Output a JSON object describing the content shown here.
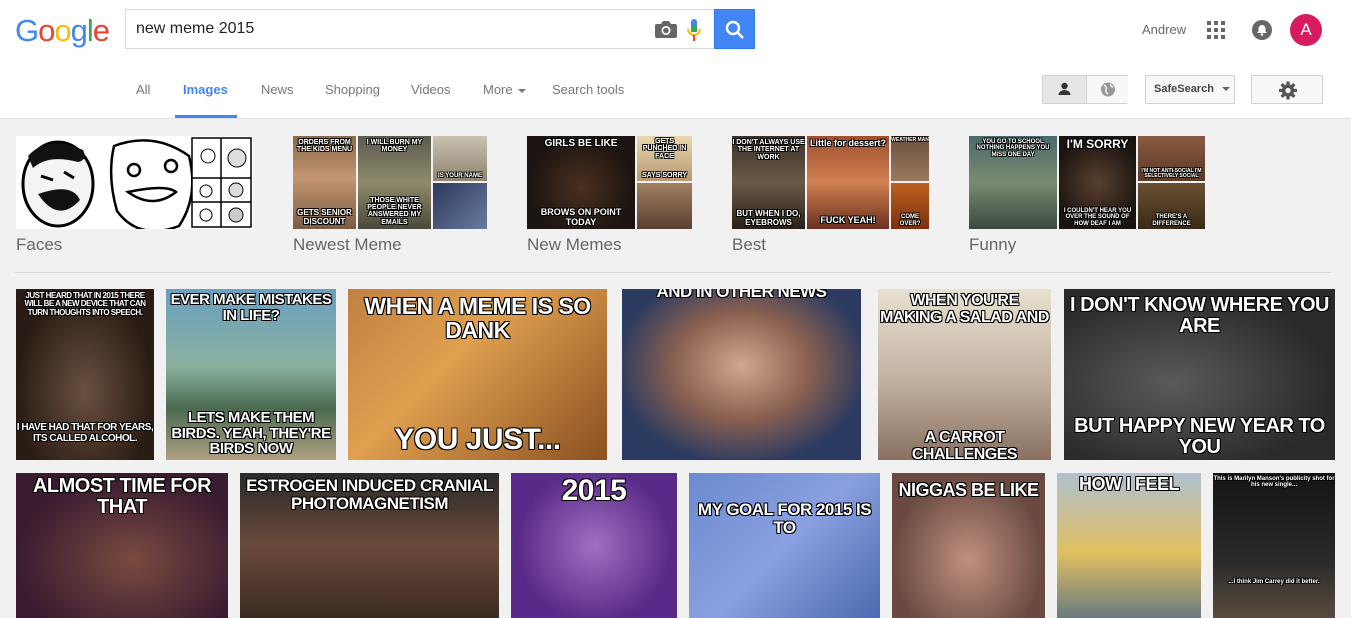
{
  "logo": {
    "letters": [
      "G",
      "o",
      "o",
      "g",
      "l",
      "e"
    ],
    "colors": [
      "#4285f4",
      "#ea4335",
      "#fbbc05",
      "#4285f4",
      "#34a853",
      "#ea4335"
    ]
  },
  "search": {
    "query": "new meme 2015"
  },
  "header": {
    "user_name": "Andrew",
    "avatar_letter": "A"
  },
  "tabs": [
    {
      "label": "All",
      "active": false
    },
    {
      "label": "Images",
      "active": true
    },
    {
      "label": "News",
      "active": false
    },
    {
      "label": "Shopping",
      "active": false
    },
    {
      "label": "Videos",
      "active": false
    },
    {
      "label": "More",
      "active": false
    },
    {
      "label": "Search tools",
      "active": false
    }
  ],
  "toolbar": {
    "safesearch_label": "SafeSearch"
  },
  "categories": [
    {
      "label": "Faces",
      "captions": []
    },
    {
      "label": "Newest Meme",
      "captions": [
        "ORDERS FROM THE KIDS MENU",
        "GETS SENIOR DISCOUNT",
        "I WILL BURN MY MONEY",
        "THOSE WHITE PEOPLE NEVER ANSWERED MY EMAILS",
        "IS YOUR NAME"
      ]
    },
    {
      "label": "New Memes",
      "captions": [
        "GIRLS BE LIKE",
        "BROWS ON POINT TODAY",
        "GETS PUNCHED IN FACE",
        "SAYS SORRY"
      ]
    },
    {
      "label": "Best",
      "captions": [
        "I DON'T ALWAYS USE THE INTERNET AT WORK",
        "BUT WHEN I DO, EYEBROWS",
        "Little for dessert?",
        "FUCK YEAH!",
        "WEATHER MAN",
        "COME OVER?"
      ]
    },
    {
      "label": "Funny",
      "captions": [
        "YOU GO TO SCHOOL NOTHING HAPPENS YOU MISS ONE DAY",
        "I'M SORRY",
        "I COULDN'T HEAR YOU OVER THE SOUND OF HOW DEAF I AM",
        "I'M NOT ANTI-SOCIAL I'M SELECTIVELY SOCIAL",
        "THERE'S A DIFFERENCE"
      ]
    }
  ],
  "results": [
    {
      "top": "JUST HEARD THAT IN 2015 THERE WILL BE A NEW DEVICE THAT CAN TURN THOUGHTS INTO SPEECH.",
      "bottom": "I HAVE HAD THAT FOR YEARS, ITS CALLED ALCOHOL."
    },
    {
      "top": "EVER MAKE MISTAKES IN LIFE?",
      "bottom": "LETS MAKE THEM BIRDS. YEAH, THEY'RE BIRDS NOW"
    },
    {
      "top": "WHEN A MEME IS SO DANK",
      "bottom": "YOU JUST..."
    },
    {
      "top": "AND IN OTHER NEWS",
      "bottom": ""
    },
    {
      "top": "WHEN YOU'RE MAKING A SALAD AND",
      "bottom": "A CARROT CHALLENGES"
    },
    {
      "top": "I DON'T KNOW WHERE YOU ARE",
      "bottom": "BUT HAPPY NEW YEAR TO YOU"
    },
    {
      "top": "ALMOST TIME FOR THAT",
      "bottom": ""
    },
    {
      "top": "ESTROGEN INDUCED CRANIAL PHOTOMAGNETISM",
      "bottom": ""
    },
    {
      "top": "2015",
      "bottom": ""
    },
    {
      "top": "MY GOAL FOR 2015 IS TO",
      "bottom": ""
    },
    {
      "top": "NIGGAS BE LIKE",
      "bottom": ""
    },
    {
      "top": "HOW I FEEL",
      "bottom": ""
    },
    {
      "top": "This is Marilyn Manson's publicity shot for his new single...",
      "bottom": "...I think Jim Carrey did it better."
    }
  ]
}
